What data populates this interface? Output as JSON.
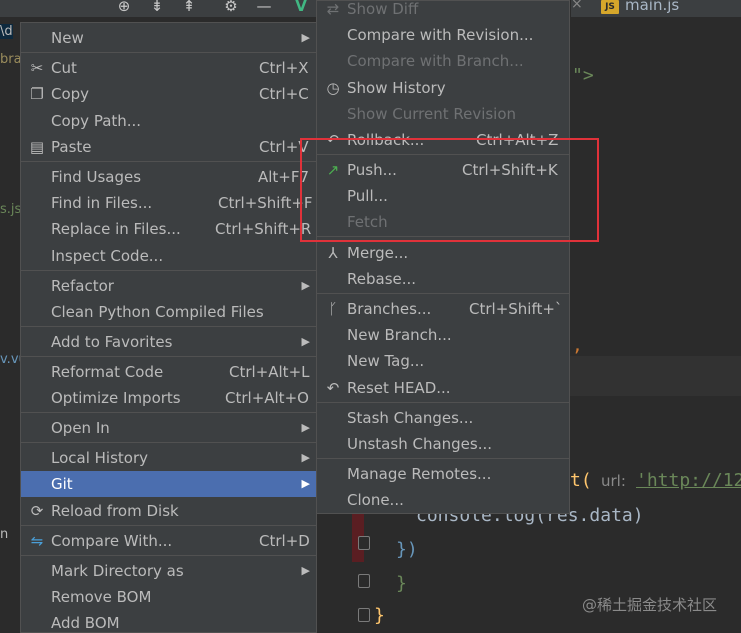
{
  "colors": {
    "accent": "#4b6eaf",
    "annotation": "#e0323a",
    "push_icon": "#4caf50"
  },
  "toolbar": {
    "icons": [
      "crosshair-icon",
      "expand-all-icon",
      "collapse-all-icon",
      "gear-icon",
      "minimize-icon",
      "vue-icon"
    ]
  },
  "editor_tab": {
    "badge": "JS",
    "label": "main.js"
  },
  "gutter_fragments": [
    "\\d",
    "bra",
    "s.js",
    "v.vu",
    "n"
  ],
  "editor": {
    "frag1": "\">",
    "frag2": ",",
    "code_line1_prefix": "t(",
    "code_line1_param": "url:",
    "code_line1_string": "'http://12",
    "code_line2": "console.log(res.data)",
    "code_line3": "})",
    "code_line4": "}",
    "code_line5": "}"
  },
  "watermark": "@稀土掘金技术社区",
  "context_menu": {
    "new": "New",
    "cut": "Cut",
    "cut_sc": "Ctrl+X",
    "copy": "Copy",
    "copy_sc": "Ctrl+C",
    "copy_path": "Copy Path...",
    "paste": "Paste",
    "paste_sc": "Ctrl+V",
    "find_usages": "Find Usages",
    "find_usages_sc": "Alt+F7",
    "find_in_files": "Find in Files...",
    "find_in_files_sc": "Ctrl+Shift+F",
    "replace_in_files": "Replace in Files...",
    "replace_in_files_sc": "Ctrl+Shift+R",
    "inspect_code": "Inspect Code...",
    "refactor": "Refactor",
    "clean_python": "Clean Python Compiled Files",
    "add_favorites": "Add to Favorites",
    "reformat": "Reformat Code",
    "reformat_sc": "Ctrl+Alt+L",
    "optimize": "Optimize Imports",
    "optimize_sc": "Ctrl+Alt+O",
    "open_in": "Open In",
    "local_history": "Local History",
    "git": "Git",
    "reload": "Reload from Disk",
    "compare_with": "Compare With...",
    "compare_with_sc": "Ctrl+D",
    "mark_directory": "Mark Directory as",
    "remove_bom": "Remove BOM",
    "add_bom": "Add BOM"
  },
  "git_menu": {
    "show_diff": "Show Diff",
    "compare_revision": "Compare with Revision...",
    "compare_branch": "Compare with Branch...",
    "show_history": "Show History",
    "show_current_revision": "Show Current Revision",
    "rollback": "Rollback...",
    "rollback_sc": "Ctrl+Alt+Z",
    "push": "Push...",
    "push_sc": "Ctrl+Shift+K",
    "pull": "Pull...",
    "fetch": "Fetch",
    "merge": "Merge...",
    "rebase": "Rebase...",
    "branches": "Branches...",
    "branches_sc": "Ctrl+Shift+`",
    "new_branch": "New Branch...",
    "new_tag": "New Tag...",
    "reset_head": "Reset HEAD...",
    "stash": "Stash Changes...",
    "unstash": "Unstash Changes...",
    "manage_remotes": "Manage Remotes...",
    "clone": "Clone..."
  }
}
